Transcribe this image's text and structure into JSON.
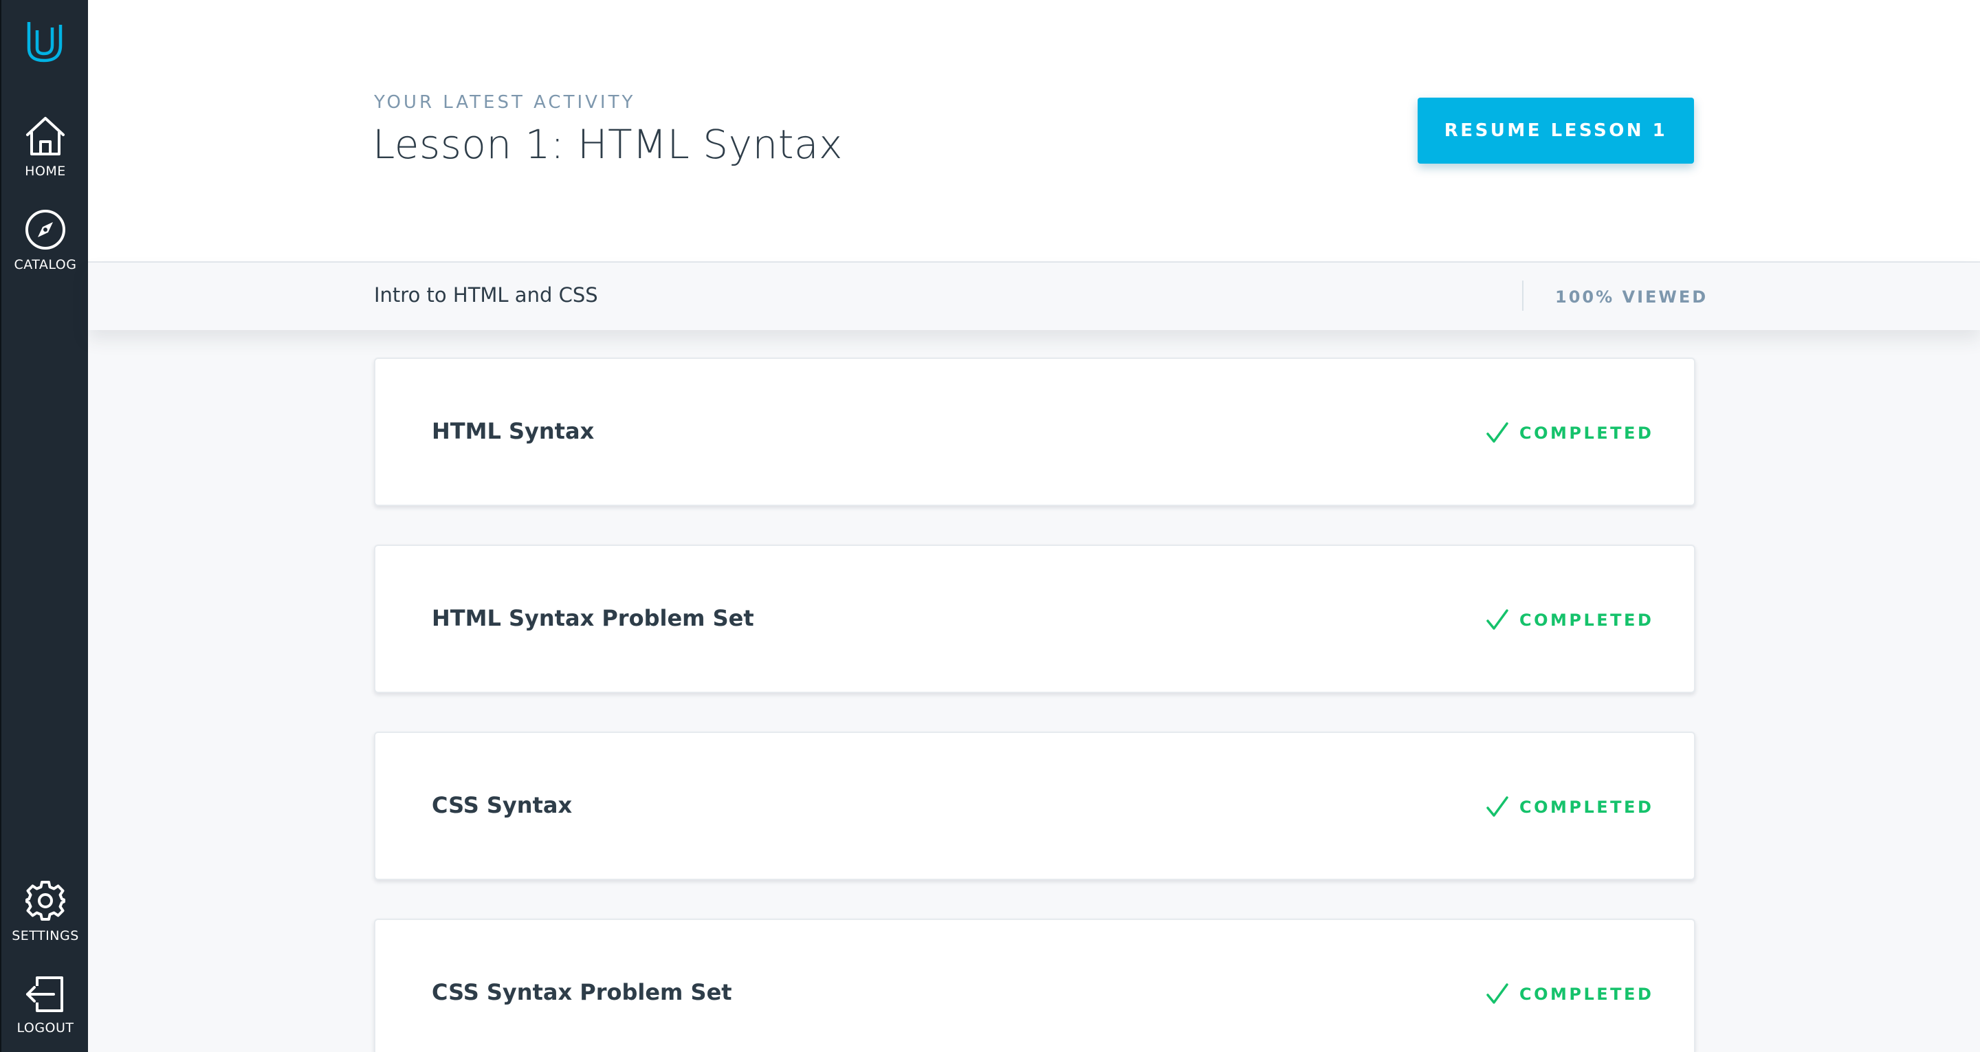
{
  "sidebar": {
    "logo": "udacity-logo",
    "items": [
      {
        "label": "HOME",
        "icon": "home-icon"
      },
      {
        "label": "CATALOG",
        "icon": "compass-icon"
      },
      {
        "label": "SETTINGS",
        "icon": "gear-icon"
      },
      {
        "label": "LOGOUT",
        "icon": "logout-icon"
      }
    ]
  },
  "header": {
    "eyebrow": "YOUR LATEST ACTIVITY",
    "title": "Lesson 1: HTML Syntax",
    "resume_label": "RESUME LESSON 1"
  },
  "course": {
    "name": "Intro to HTML and CSS",
    "progress_label": "100% VIEWED",
    "progress": 1.0
  },
  "concepts": [
    {
      "title": "HTML Syntax",
      "status": "COMPLETED"
    },
    {
      "title": "HTML Syntax Problem Set",
      "status": "COMPLETED"
    },
    {
      "title": "CSS Syntax",
      "status": "COMPLETED"
    },
    {
      "title": "CSS Syntax Problem Set",
      "status": "COMPLETED"
    }
  ],
  "colors": {
    "sidebar_bg": "#1f2933",
    "accent": "#02b3e4",
    "completed": "#15c26b",
    "muted_text": "#7d97ad",
    "body_text": "#2e3d49"
  }
}
